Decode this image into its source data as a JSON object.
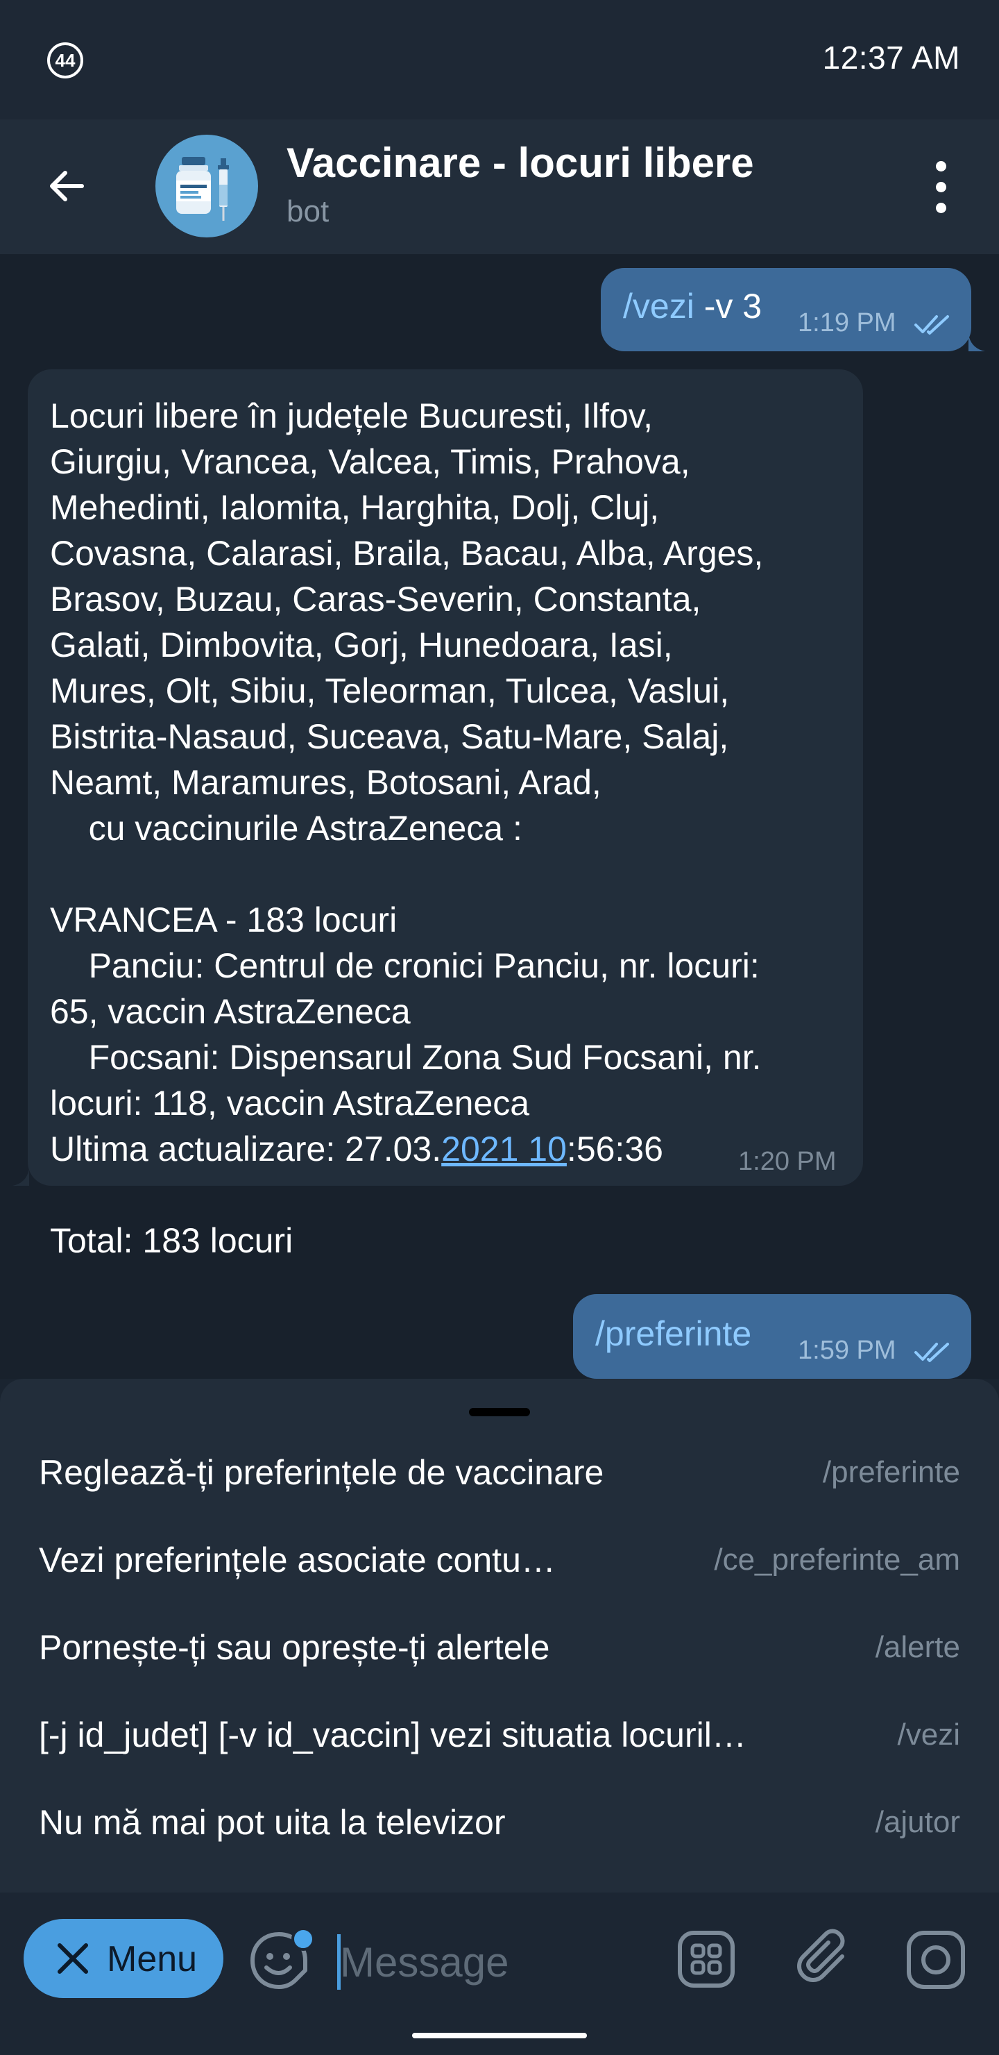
{
  "status_bar": {
    "badge": "44",
    "time": "12:37 AM"
  },
  "header": {
    "title": "Vaccinare - locuri libere",
    "subtitle": "bot"
  },
  "messages": [
    {
      "direction": "outgoing",
      "command": "/vezi",
      "args": " -v 3",
      "time": "1:19 PM",
      "status": "read"
    },
    {
      "direction": "incoming",
      "text_before_link": "Locuri libere în județele Bucuresti, Ilfov,\nGiurgiu, Vrancea, Valcea, Timis, Prahova,\nMehedinti, Ialomita, Harghita, Dolj, Cluj,\nCovasna, Calarasi, Braila, Bacau, Alba, Arges,\nBrasov, Buzau, Caras-Severin, Constanta,\nGalati, Dimbovita, Gorj, Hunedoara, Iasi,\nMures, Olt, Sibiu, Teleorman, Tulcea, Vaslui,\nBistrita-Nasaud, Suceava, Satu-Mare, Salaj,\nNeamt, Maramures, Botosani, Arad,\n    cu vaccinurile AstraZeneca :\n\nVRANCEA - 183 locuri\n    Panciu: Centrul de cronici Panciu, nr. locuri:\n65, vaccin AstraZeneca\n    Focsani: Dispensarul Zona Sud Focsani, nr.\nlocuri: 118, vaccin AstraZeneca\nUltima actualizare: 27.03.",
      "link_text": "2021 10",
      "text_after_link": ":56:36\n\nTotal: 183 locuri",
      "time": "1:20 PM"
    },
    {
      "direction": "outgoing",
      "command": "/preferinte",
      "args": "",
      "time": "1:59 PM",
      "status": "read"
    }
  ],
  "commands": [
    {
      "description": "Reglează-ți preferințele de vaccinare",
      "command": "/preferinte"
    },
    {
      "description": "Vezi preferințele asociate contu…",
      "command": "/ce_preferinte_am"
    },
    {
      "description": "Pornește-ți sau oprește-ți alertele",
      "command": "/alerte"
    },
    {
      "description": "[-j id_judet] [-v id_vaccin] vezi situatia locuril…",
      "command": "/vezi"
    },
    {
      "description": "Nu mă mai pot uita la televizor",
      "command": "/ajutor"
    }
  ],
  "input_bar": {
    "menu_label": "Menu",
    "placeholder": "Message"
  },
  "colors": {
    "accent": "#4a9ee0",
    "outgoing_bubble": "#3d6a99",
    "incoming_bubble": "#222e3b",
    "link": "#6eb8ff"
  },
  "icons": [
    "back-arrow-icon",
    "more-vert-icon",
    "double-check-icon",
    "close-icon",
    "sticker-icon",
    "bot-commands-icon",
    "attach-icon",
    "camera-icon"
  ]
}
